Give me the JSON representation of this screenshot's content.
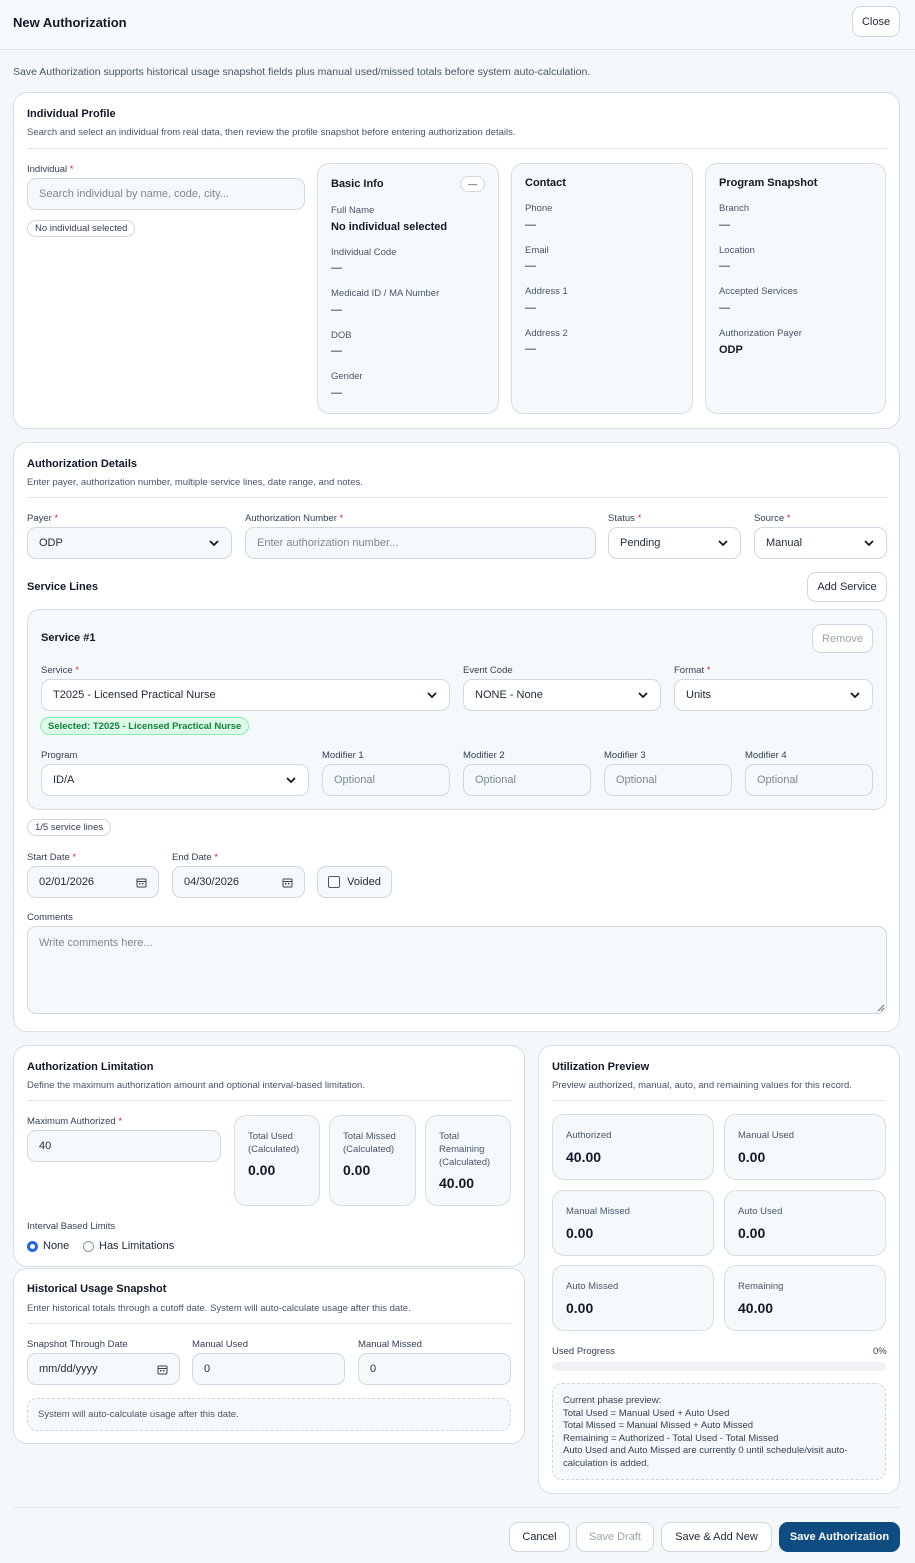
{
  "header": {
    "title": "New Authorization",
    "close_label": "Close"
  },
  "intro": "Save Authorization supports historical usage snapshot fields plus manual used/missed totals before system auto-calculation.",
  "profile": {
    "title": "Individual Profile",
    "subtitle": "Search and select an individual from real data, then review the profile snapshot before entering authorization details.",
    "individual_label": "Individual",
    "search_placeholder": "Search individual by name, code, city...",
    "selected_badge": "No individual selected",
    "basic": {
      "title": "Basic Info",
      "collapse": "—",
      "full_name_label": "Full Name",
      "full_name": "No individual selected",
      "code_label": "Individual Code",
      "code": "—",
      "medicaid_label": "Medicaid ID / MA Number",
      "medicaid": "—",
      "dob_label": "DOB",
      "dob": "—",
      "gender_label": "Gender",
      "gender": "—"
    },
    "contact": {
      "title": "Contact",
      "phone_label": "Phone",
      "phone": "—",
      "email_label": "Email",
      "email": "—",
      "addr1_label": "Address 1",
      "addr1": "—",
      "addr2_label": "Address 2",
      "addr2": "—"
    },
    "program": {
      "title": "Program Snapshot",
      "branch_label": "Branch",
      "branch": "—",
      "location_label": "Location",
      "location": "—",
      "services_label": "Accepted Services",
      "services": "—",
      "payer_label": "Authorization Payer",
      "payer": "ODP"
    }
  },
  "details": {
    "title": "Authorization Details",
    "subtitle": "Enter payer, authorization number, multiple service lines, date range, and notes.",
    "payer_label": "Payer",
    "payer": "ODP",
    "authnum_label": "Authorization Number",
    "authnum_placeholder": "Enter authorization number...",
    "status_label": "Status",
    "status": "Pending",
    "source_label": "Source",
    "source": "Manual",
    "service_lines_title": "Service Lines",
    "add_service": "Add Service",
    "service": {
      "title": "Service #1",
      "remove": "Remove",
      "service_label": "Service",
      "service_value": "T2025 - Licensed Practical Nurse",
      "event_label": "Event Code",
      "event_value": "NONE - None",
      "format_label": "Format",
      "format_value": "Units",
      "selected_badge": "Selected: T2025 - Licensed Practical Nurse",
      "program_label": "Program",
      "program_value": "ID/A",
      "mod1_label": "Modifier 1",
      "mod2_label": "Modifier 2",
      "mod3_label": "Modifier 3",
      "mod4_label": "Modifier 4",
      "mod_placeholder": "Optional"
    },
    "lines_count": "1/5 service lines",
    "start_label": "Start Date",
    "start": "02/01/2026",
    "end_label": "End Date",
    "end": "04/30/2026",
    "voided_label": "Voided",
    "comments_label": "Comments",
    "comments_placeholder": "Write comments here..."
  },
  "limitation": {
    "title": "Authorization Limitation",
    "subtitle": "Define the maximum authorization amount and optional interval-based limitation.",
    "max_label": "Maximum Authorized",
    "max_value": "40",
    "used_label": "Total Used (Calculated)",
    "used": "0.00",
    "missed_label": "Total Missed (Calculated)",
    "missed": "0.00",
    "remaining_label": "Total Remaining (Calculated)",
    "remaining": "40.00",
    "interval_label": "Interval Based Limits",
    "opt_none": "None",
    "opt_has": "Has Limitations"
  },
  "snapshot": {
    "title": "Historical Usage Snapshot",
    "subtitle": "Enter historical totals through a cutoff date. System will auto-calculate usage after this date.",
    "through_label": "Snapshot Through Date",
    "through_placeholder": "mm/dd/yyyy",
    "manual_used_label": "Manual Used",
    "manual_used": "0",
    "manual_missed_label": "Manual Missed",
    "manual_missed": "0",
    "note": "System will auto-calculate usage after this date."
  },
  "utilization": {
    "title": "Utilization Preview",
    "subtitle": "Preview authorized, manual, auto, and remaining values for this record.",
    "authorized_label": "Authorized",
    "authorized": "40.00",
    "manual_used_label": "Manual Used",
    "manual_used": "0.00",
    "manual_missed_label": "Manual Missed",
    "manual_missed": "0.00",
    "auto_used_label": "Auto Used",
    "auto_used": "0.00",
    "auto_missed_label": "Auto Missed",
    "auto_missed": "0.00",
    "remaining_label": "Remaining",
    "remaining": "40.00",
    "progress_label": "Used Progress",
    "progress_text": "0%",
    "progress_fraction": 0,
    "phase_lines": [
      "Current phase preview:",
      "Total Used = Manual Used + Auto Used",
      "Total Missed = Manual Missed + Auto Missed",
      "Remaining = Authorized - Total Used - Total Missed",
      "Auto Used and Auto Missed are currently 0 until schedule/visit auto-",
      "calculation is added."
    ]
  },
  "footer": {
    "cancel": "Cancel",
    "save_draft": "Save Draft",
    "save_add_new": "Save & Add New",
    "save": "Save Authorization"
  },
  "colors": {
    "primary": "#0f4c81",
    "required": "#dc2626",
    "radio_on": "#2563eb",
    "badge_green": "#15803d"
  }
}
